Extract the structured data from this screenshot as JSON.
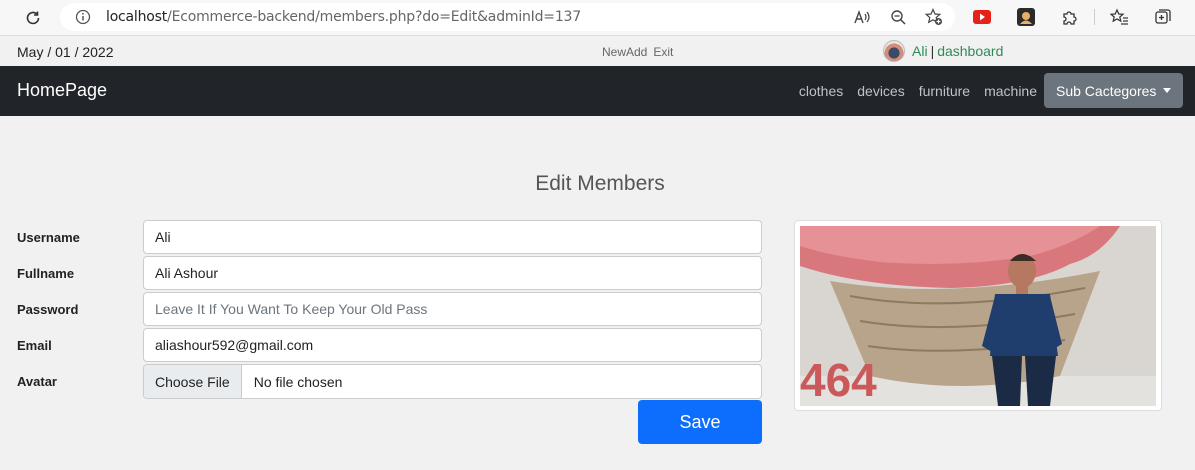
{
  "browser": {
    "url_host": "localhost",
    "url_path": "/Ecommerce-backend/members.php?do=Edit&adminId=137"
  },
  "infobar": {
    "date": "May / 01 / 2022",
    "links": [
      "NewAdd",
      "Exit"
    ],
    "user_name": "Ali",
    "separator": "|",
    "dashboard_label": "dashboard"
  },
  "navbar": {
    "brand": "HomePage",
    "links": [
      "clothes",
      "devices",
      "furniture",
      "machine"
    ],
    "dropdown_label": "Sub Cactegores"
  },
  "form": {
    "title": "Edit Members",
    "fields": [
      {
        "label": "Username",
        "value": "Ali"
      },
      {
        "label": "Fullname",
        "value": "Ali Ashour"
      },
      {
        "label": "Password",
        "placeholder": "Leave It If You Want To Keep Your Old Pass"
      },
      {
        "label": "Email",
        "value": "aliashour592@gmail.com"
      },
      {
        "label": "Avatar",
        "file_button": "Choose File",
        "file_status": "No file chosen"
      }
    ],
    "save_label": "Save"
  },
  "avatar_image": {
    "overlay_text": "464"
  },
  "colors": {
    "navbar_bg": "#212529",
    "primary_button": "#0d6efd",
    "dropdown_button": "#6c757d",
    "link_green": "#2e8b57"
  }
}
